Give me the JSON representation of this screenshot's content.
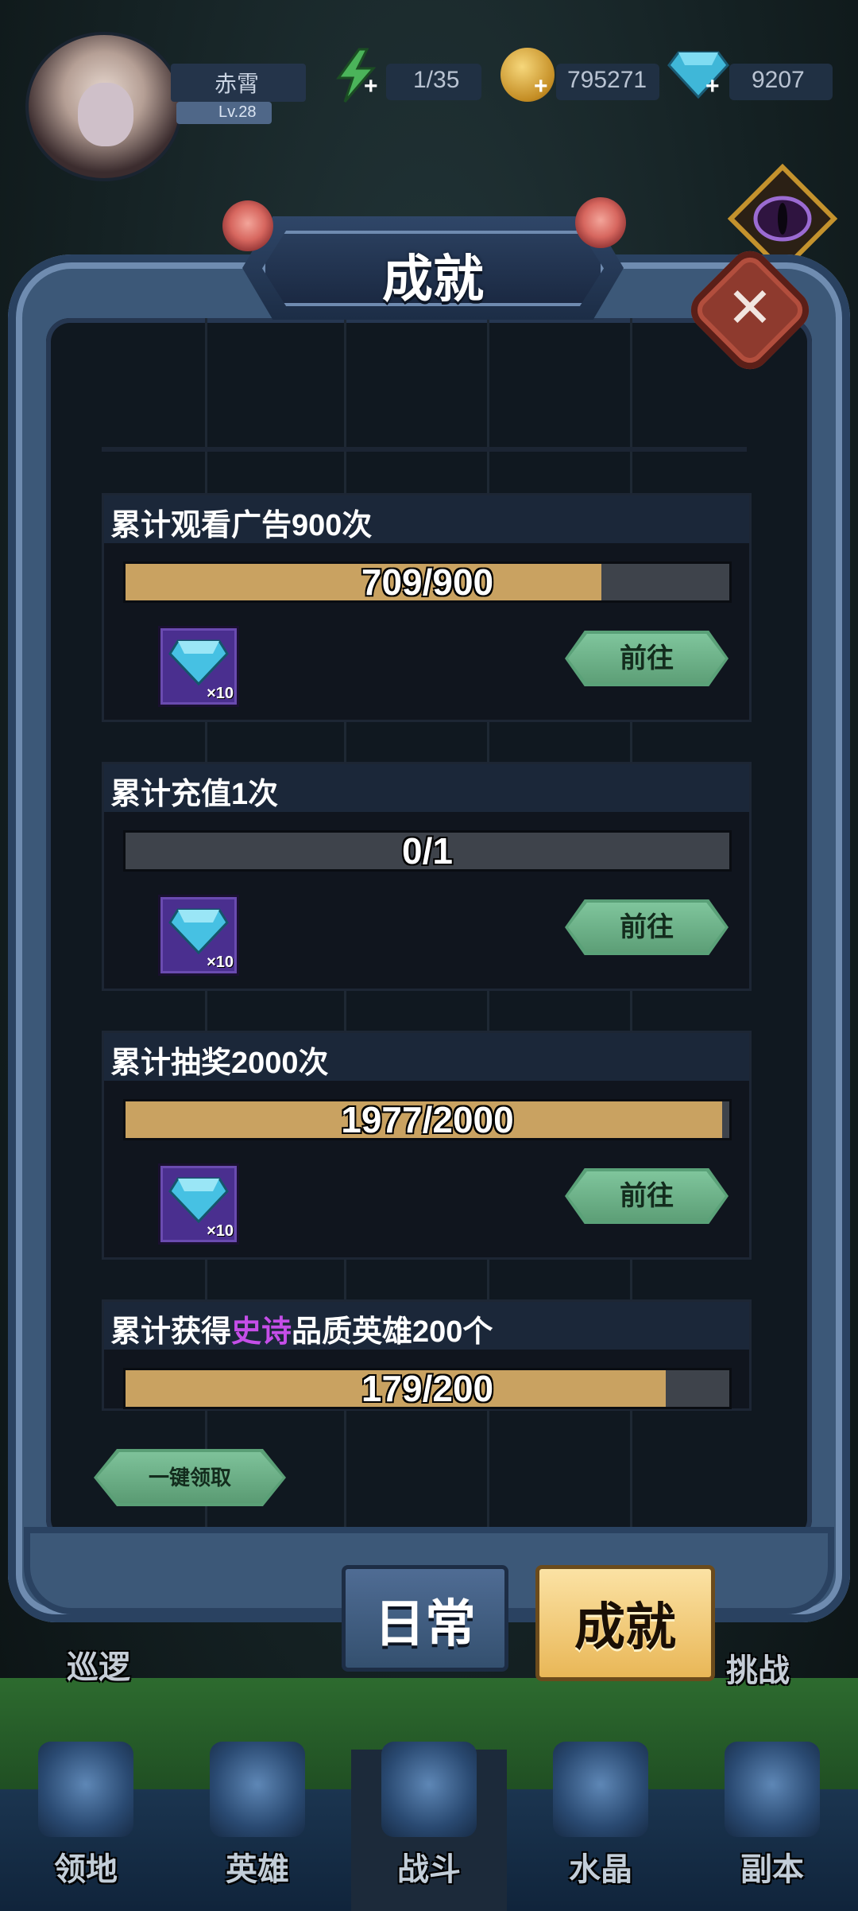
{
  "player": {
    "name": "赤霄",
    "level": "Lv.28"
  },
  "resources": {
    "energy": "1/35",
    "gold": "795271",
    "diamonds": "9207"
  },
  "dialog": {
    "title": "成就",
    "close_icon": "close-icon"
  },
  "achievements": [
    {
      "title": "累计观看广告900次",
      "progress_text": "709/900",
      "progress": 0.788,
      "reward_icon": "diamond-icon",
      "reward_count": "×10",
      "button": "前往"
    },
    {
      "title": "累计充值1次",
      "progress_text": "0/1",
      "progress": 0.0,
      "reward_icon": "diamond-icon",
      "reward_count": "×10",
      "button": "前往"
    },
    {
      "title": "累计抽奖2000次",
      "progress_text": "1977/2000",
      "progress": 0.9885,
      "reward_icon": "diamond-icon",
      "reward_count": "×10",
      "button": "前往"
    },
    {
      "title_parts": {
        "pre": "累计获得",
        "highlight": "史诗",
        "post": "品质英雄200个"
      },
      "progress_text": "179/200",
      "progress": 0.895
    }
  ],
  "collect_all": "一键领取",
  "tabs": {
    "daily": "日常",
    "achievement": "成就"
  },
  "scene": {
    "left_label": "巡逻",
    "right_label": "挑战"
  },
  "nav": [
    {
      "label": "领地",
      "icon": "territory-icon"
    },
    {
      "label": "英雄",
      "icon": "hero-icon"
    },
    {
      "label": "战斗",
      "icon": "battle-icon"
    },
    {
      "label": "水晶",
      "icon": "crystal-icon"
    },
    {
      "label": "副本",
      "icon": "dungeon-icon"
    }
  ],
  "colors": {
    "progress_fill": "#c9a261",
    "highlight_text": "#c54ee8",
    "goto_button": "#7fc59c",
    "active_tab": "#e9b757"
  }
}
